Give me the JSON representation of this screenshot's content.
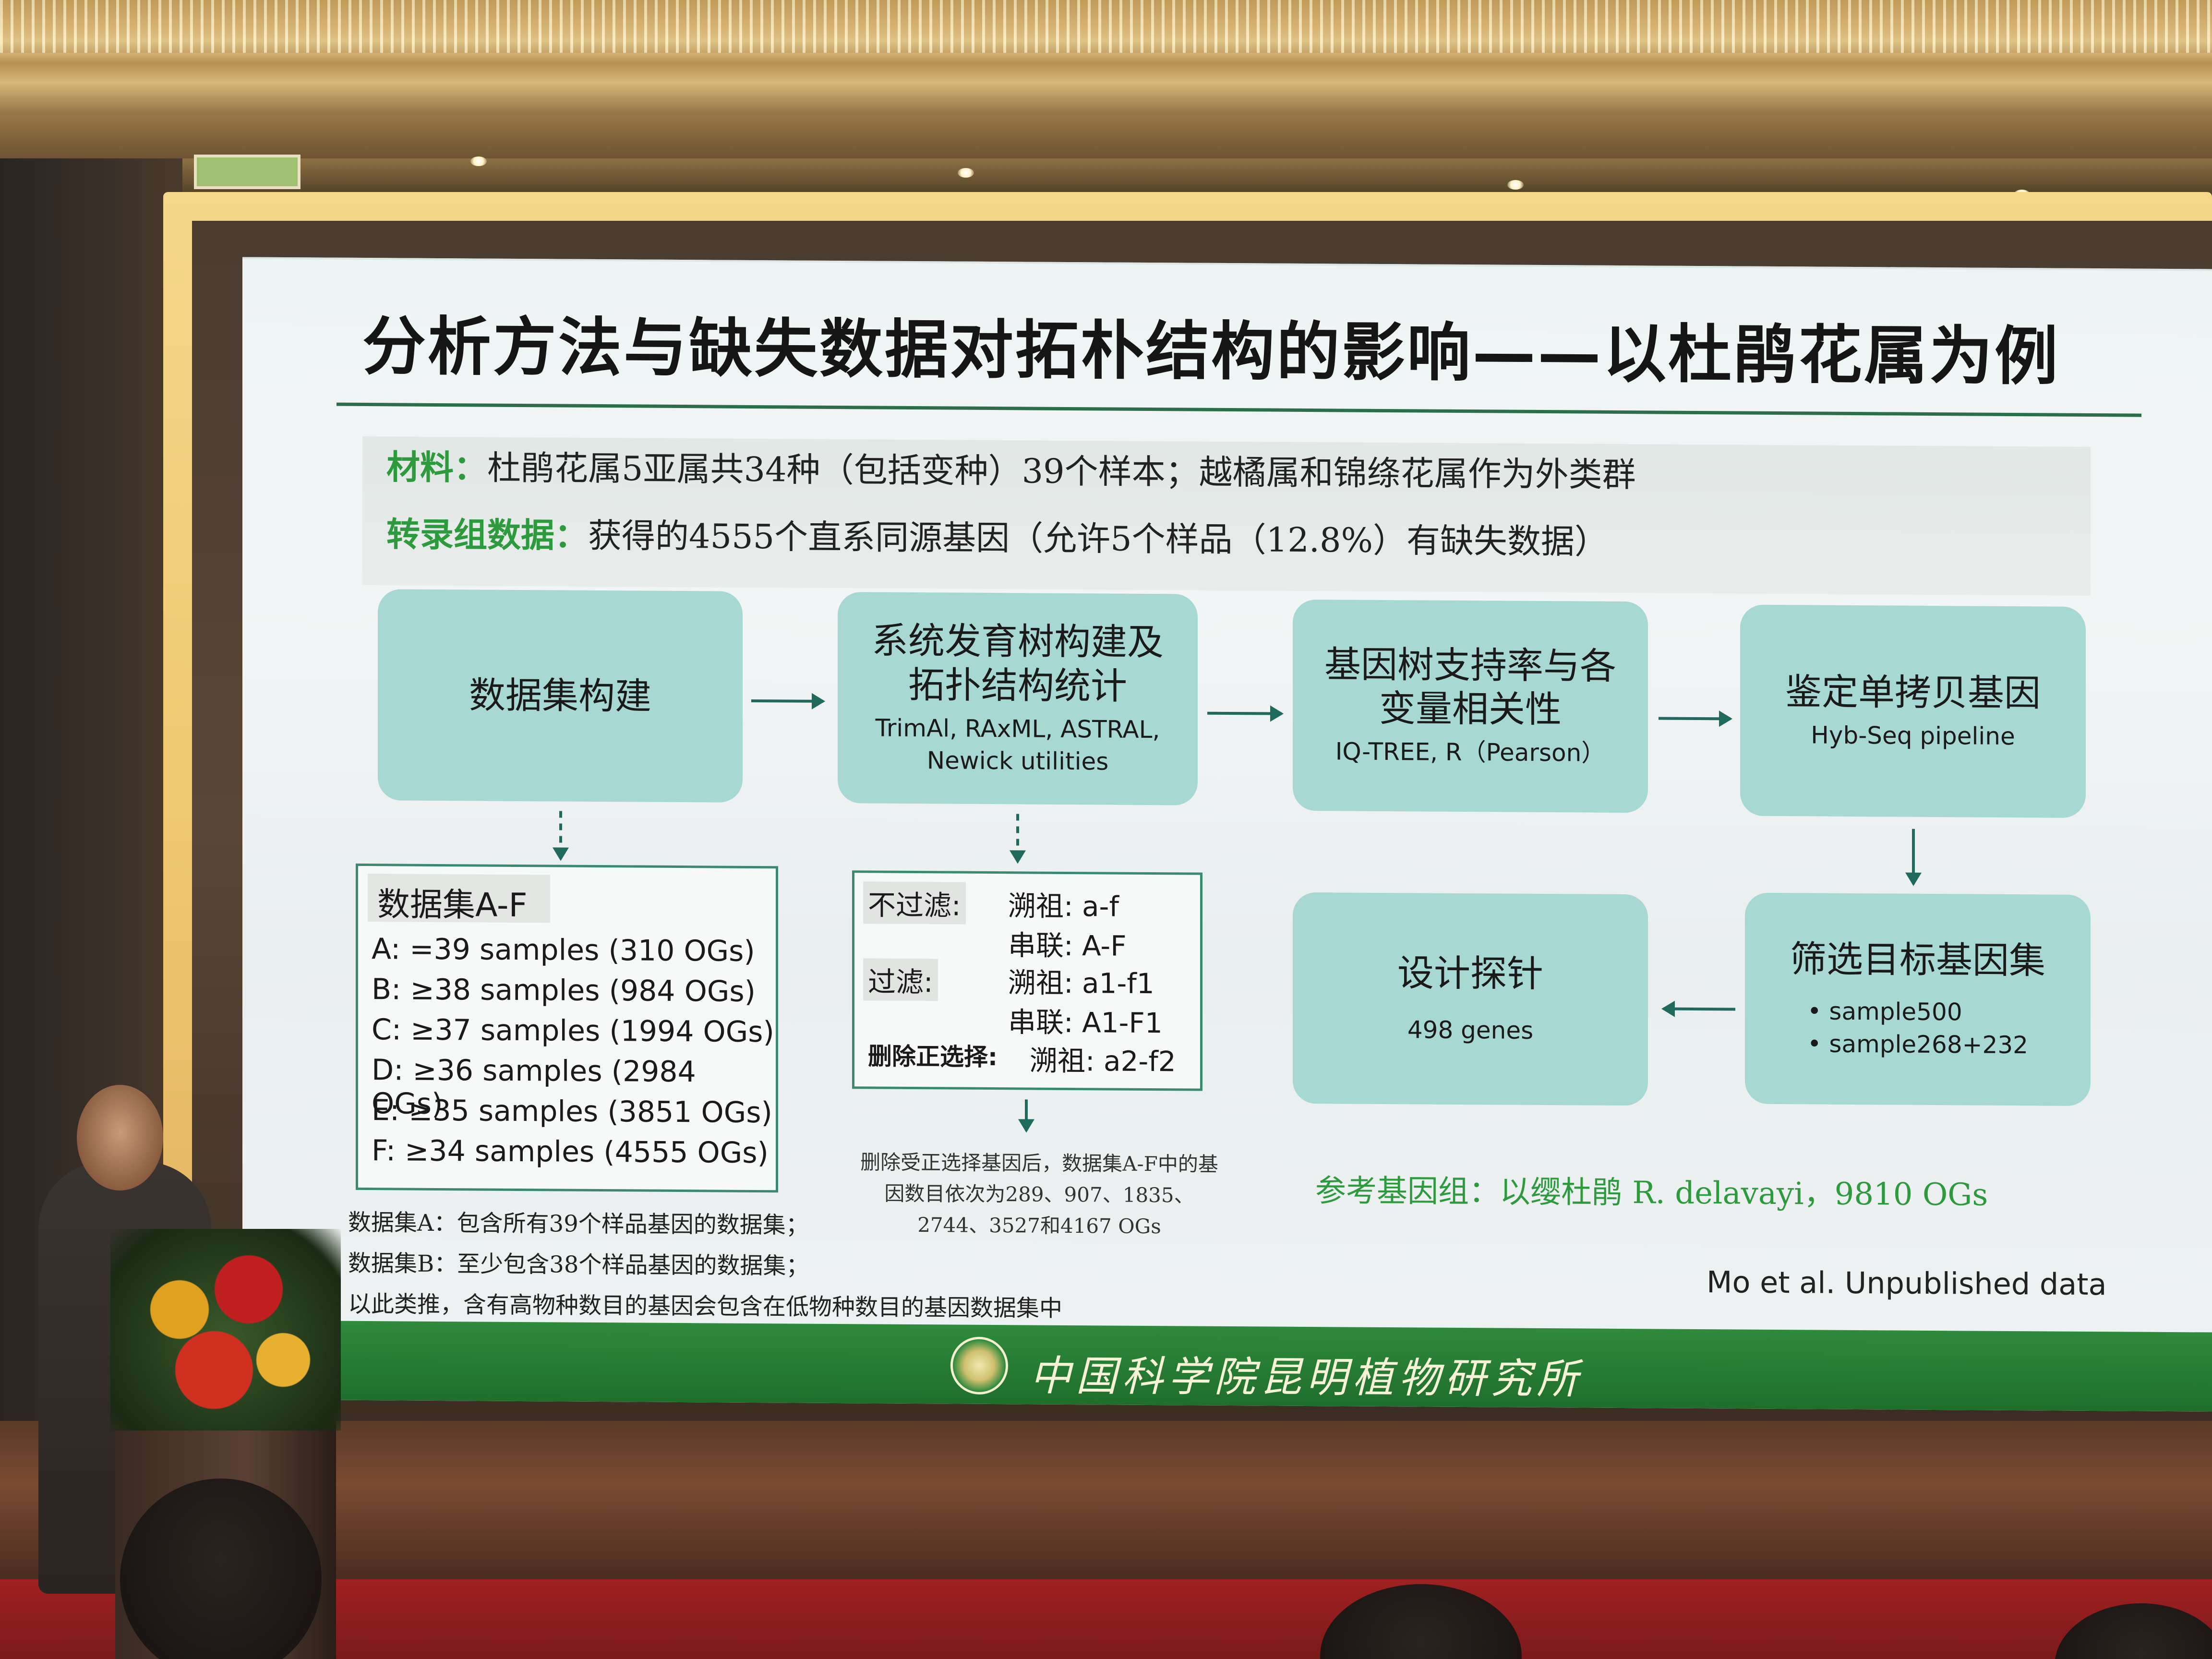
{
  "slide": {
    "title": "分析方法与缺失数据对拓朴结构的影响——以杜鹃花属为例",
    "materials_label": "材料：",
    "materials_text": "杜鹃花属5亚属共34种（包括变种）39个样本；越橘属和锦绦花属作为外类群",
    "transcriptome_label": "转录组数据：",
    "transcriptome_text": "获得的4555个直系同源基因（允许5个样品（12.8%）有缺失数据）",
    "boxes": {
      "dataset_build": "数据集构建",
      "phylo_title": "系统发育树构建及拓扑结构统计",
      "phylo_sub": "TrimAl, RAxML, ASTRAL, Newick utilities",
      "genetree_title": "基因树支持率与各变量相关性",
      "genetree_sub": "IQ-TREE, R（Pearson）",
      "single_copy_title": "鉴定单拷贝基因",
      "single_copy_sub": "Hyb-Seq pipeline",
      "probe_title": "设计探针",
      "probe_sub": "498 genes",
      "target_title": "筛选目标基因集",
      "target_item1": "sample500",
      "target_item2": "sample268+232"
    },
    "datasets": {
      "header": "数据集A-F",
      "rows": [
        "A: =39 samples (310 OGs)",
        "B: ≥38 samples (984 OGs)",
        "C: ≥37 samples (1994 OGs)",
        "D: ≥36 samples (2984 OGs)",
        "E: ≥35 samples (3851 OGs)",
        "F: ≥34 samples (4555 OGs)"
      ]
    },
    "filters": {
      "no_filter_label": "不过滤:",
      "no_filter_coalescent": "溯祖: a-f",
      "no_filter_concat": "串联: A-F",
      "filter_label": "过滤:",
      "filter_coalescent": "溯祖: a1-f1",
      "filter_concat": "串联: A1-F1",
      "positive_label": "删除正选择:",
      "positive_coalescent": "溯祖: a2-f2"
    },
    "positive_note": "删除受正选择基因后，数据集A-F中的基因数目依次为289、907、1835、2744、3527和4167 OGs",
    "footnotes": [
      "数据集A：包含所有39个样品基因的数据集；",
      "数据集B：至少包含38个样品基因的数据集；",
      "以此类推，含有高物种数目的基因会包含在低物种数目的基因数据集中"
    ],
    "reference_genome": "参考基因组：以缨杜鹃 R. delavayi，9810 OGs",
    "credit": "Mo et al. Unpublished data",
    "institute": "中国科学院昆明植物研究所"
  },
  "colors": {
    "accent_green": "#2e9a3e",
    "box_fill": "#a8d8d4",
    "arrow": "#1f6a5c",
    "footer_bar": "#1f6e2c"
  }
}
